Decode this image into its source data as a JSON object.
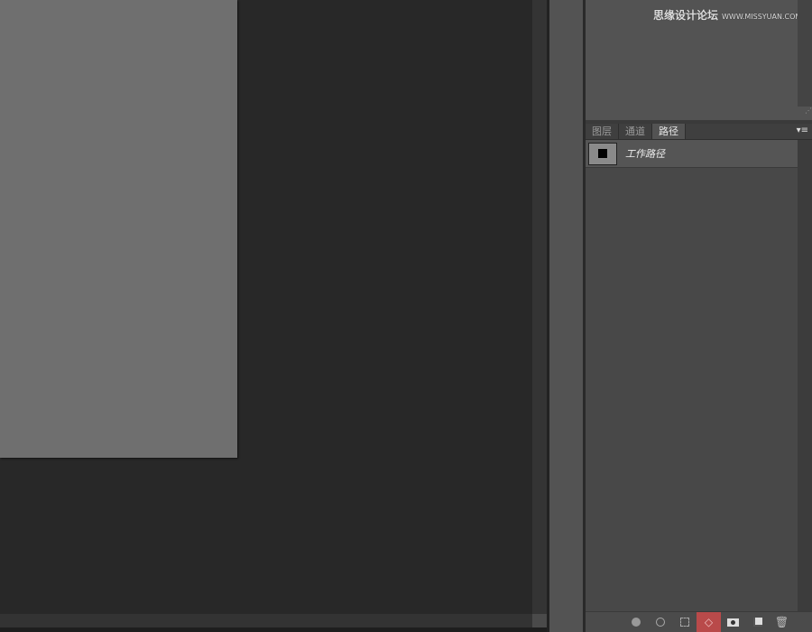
{
  "watermark": {
    "cn": "思缘设计论坛",
    "url": "WWW.MISSYUAN.COM"
  },
  "tabs": [
    {
      "label": "图层",
      "active": false
    },
    {
      "label": "通道",
      "active": false
    },
    {
      "label": "路径",
      "active": true
    }
  ],
  "panel_menu_icon": "panel-menu-icon",
  "paths": [
    {
      "label": "工作路径"
    }
  ],
  "toolbar": {
    "icons": [
      "fill-path-icon",
      "stroke-path-icon",
      "load-selection-icon",
      "make-work-path-icon",
      "add-mask-icon",
      "new-path-icon",
      "delete-icon"
    ],
    "highlight_color": "#b94a4a"
  }
}
